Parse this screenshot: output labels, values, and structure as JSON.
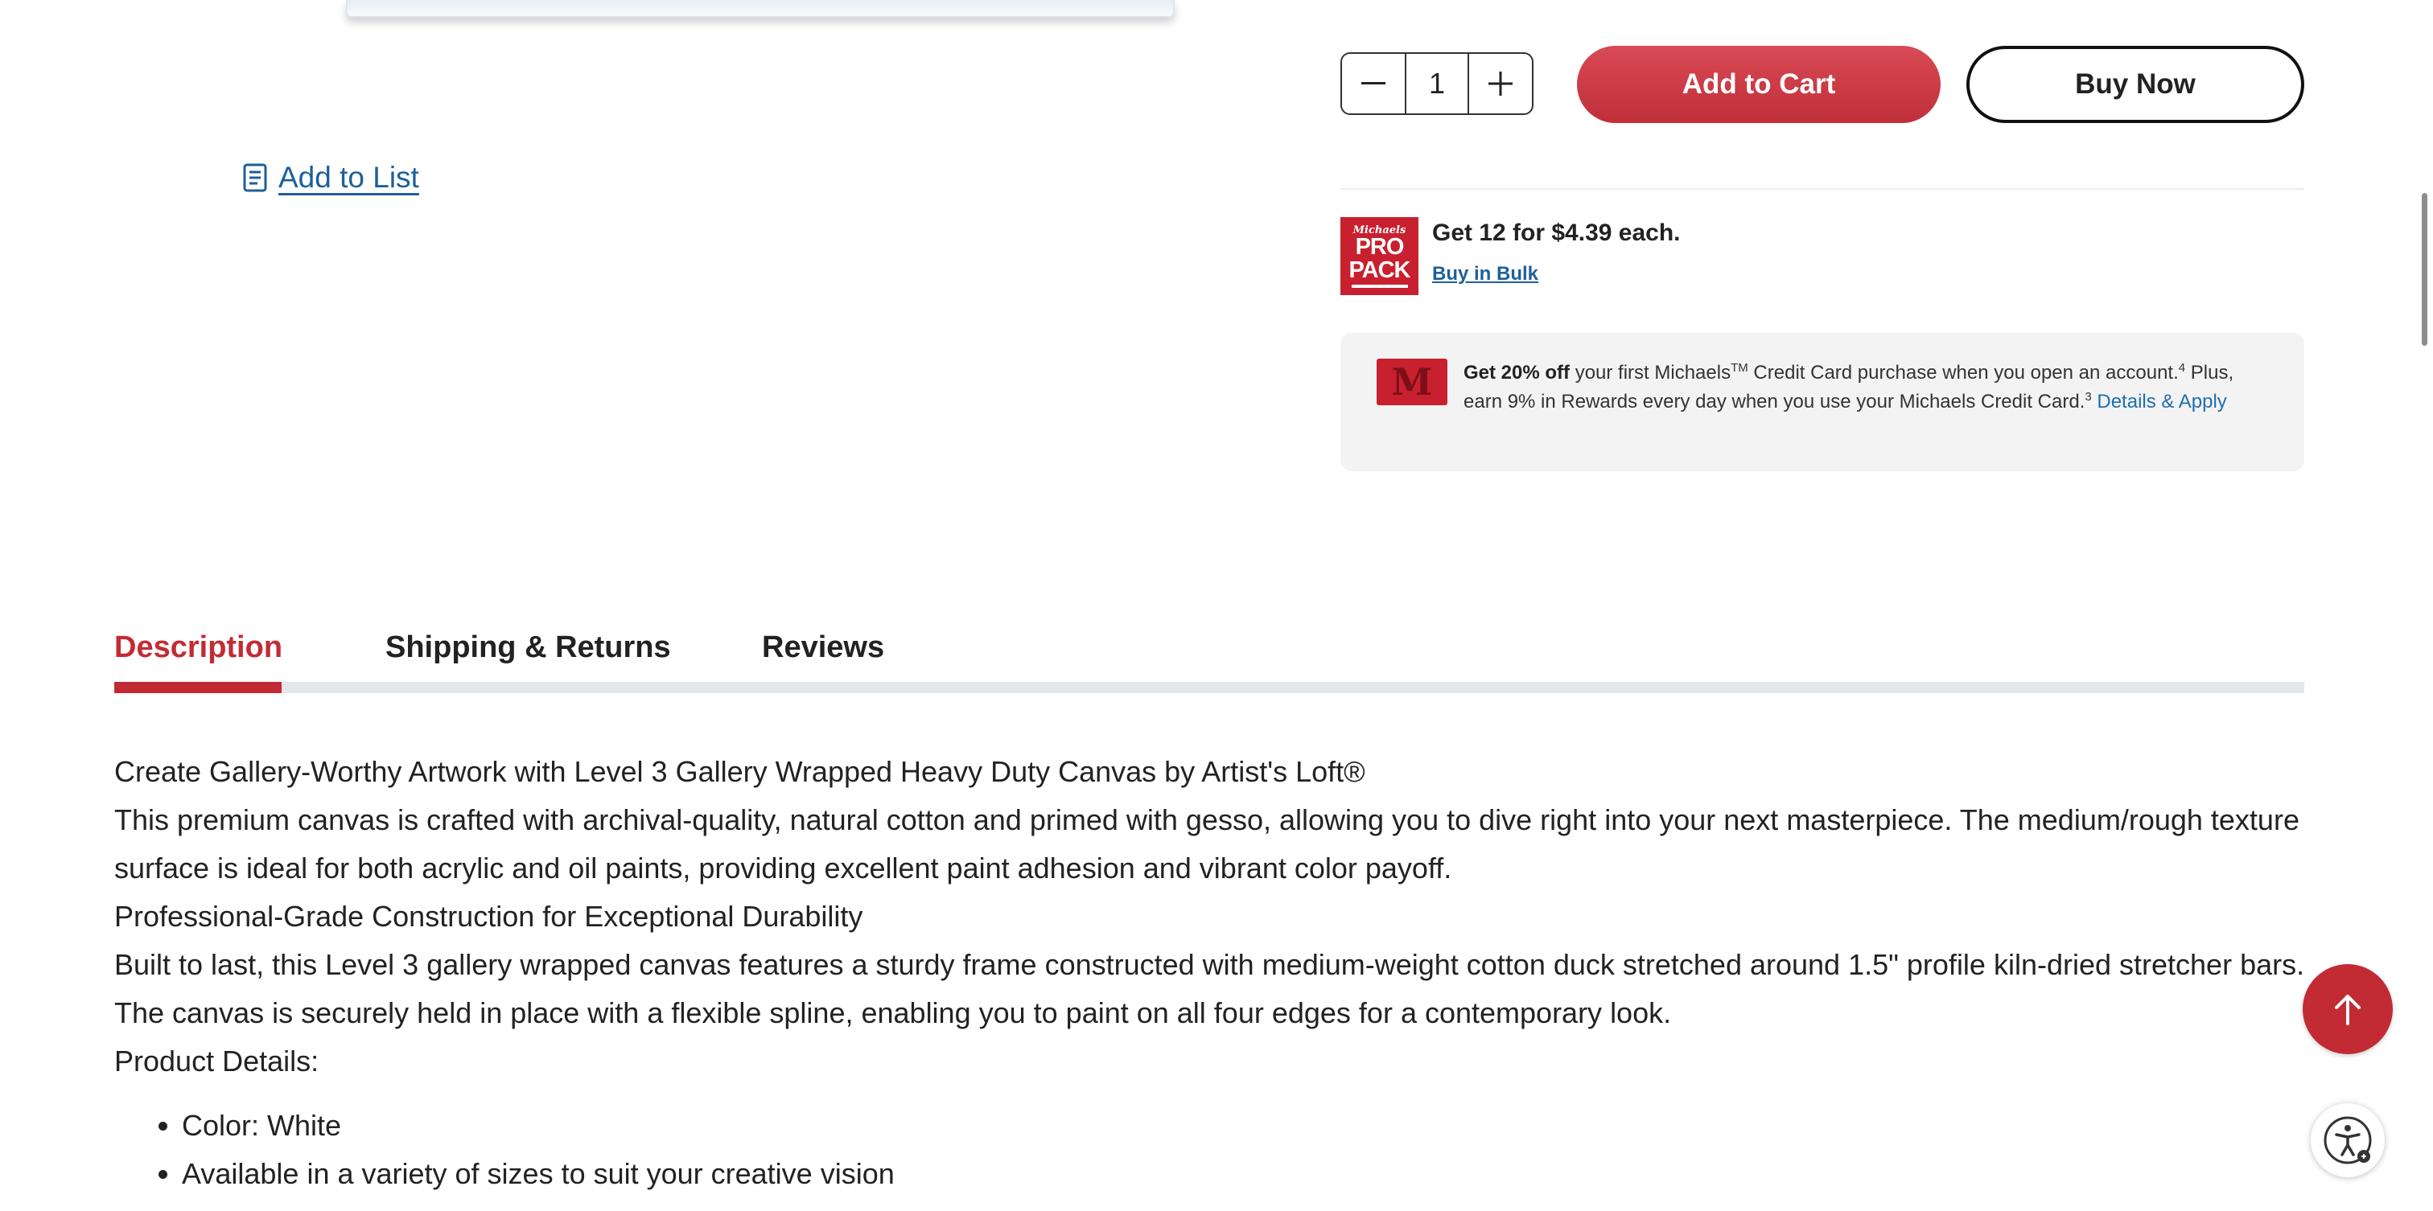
{
  "actions": {
    "add_to_list": "Add to List",
    "quantity": "1",
    "add_to_cart": "Add to Cart",
    "buy_now": "Buy Now"
  },
  "bulk": {
    "logo_small": "Michaels",
    "logo_line1": "PRO",
    "logo_line2": "PACK",
    "title": "Get 12 for $4.39 each.",
    "link": "Buy in Bulk"
  },
  "credit": {
    "lead_bold": "Get 20% off",
    "text1": " your first Michaels",
    "tm": "TM",
    "text2": " Credit Card purchase when you open an account.",
    "sup1": "4",
    "text3": " Plus, earn 9% in Rewards every day when you use your Michaels Credit Card.",
    "sup2": "3",
    "link": "Details & Apply"
  },
  "tabs": {
    "description": "Description",
    "shipping": "Shipping & Returns",
    "reviews": "Reviews"
  },
  "description": {
    "heading1": "Create Gallery-Worthy Artwork with Level 3 Gallery Wrapped Heavy Duty Canvas by Artist's Loft®",
    "para1": "This premium canvas is crafted with archival-quality, natural cotton and primed with gesso, allowing you to dive right into your next masterpiece. The medium/rough texture surface is ideal for both acrylic and oil paints, providing excellent paint adhesion and vibrant color payoff.",
    "heading2": "Professional-Grade Construction for Exceptional Durability",
    "para2": "Built to last, this Level 3 gallery wrapped canvas features a sturdy frame constructed with medium-weight cotton duck stretched around 1.5\" profile kiln-dried stretcher bars. The canvas is securely held in place with a flexible spline, enabling you to paint on all four edges for a contemporary look.",
    "details_label": "Product Details:",
    "details": [
      "Color: White",
      "Available in a variety of sizes to suit your creative vision"
    ]
  },
  "icons": {
    "list": "list-icon",
    "minus": "minus-icon",
    "plus": "plus-icon",
    "back_to_top": "arrow-up-icon",
    "accessibility": "accessibility-icon"
  },
  "colors": {
    "brand_red": "#c32b34",
    "link_blue": "#1e5f9a"
  }
}
